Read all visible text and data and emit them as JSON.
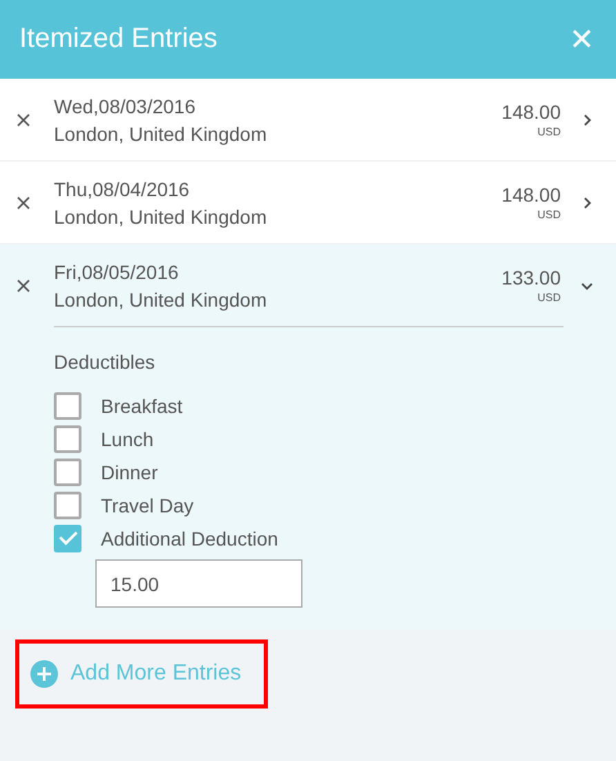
{
  "header": {
    "title": "Itemized Entries",
    "close": "✕"
  },
  "entries": [
    {
      "date": "Wed,08/03/2016",
      "location": "London, United Kingdom",
      "amount": "148.00",
      "currency": "USD",
      "expanded": false
    },
    {
      "date": "Thu,08/04/2016",
      "location": "London, United Kingdom",
      "amount": "148.00",
      "currency": "USD",
      "expanded": false
    },
    {
      "date": "Fri,08/05/2016",
      "location": "London, United Kingdom",
      "amount": "133.00",
      "currency": "USD",
      "expanded": true,
      "deductibles": {
        "title": "Deductibles",
        "items": [
          {
            "label": "Breakfast",
            "checked": false
          },
          {
            "label": "Lunch",
            "checked": false
          },
          {
            "label": "Dinner",
            "checked": false
          },
          {
            "label": "Travel Day",
            "checked": false
          },
          {
            "label": "Additional Deduction",
            "checked": true,
            "value": "15.00"
          }
        ]
      }
    }
  ],
  "add_button": {
    "label": "Add More Entries",
    "highlighted": true
  }
}
